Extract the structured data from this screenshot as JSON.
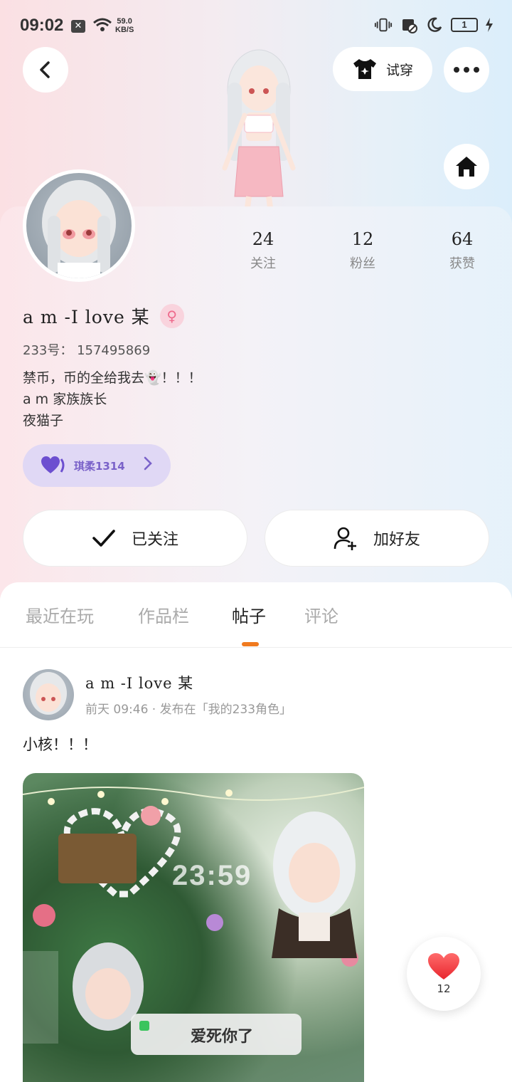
{
  "status_bar": {
    "time": "09:02",
    "net_speed_value": "59.0",
    "net_speed_unit": "KB/S",
    "battery": "1"
  },
  "header": {
    "try_on_label": "试穿"
  },
  "profile": {
    "stats": [
      {
        "value": "24",
        "label": "关注"
      },
      {
        "value": "12",
        "label": "粉丝"
      },
      {
        "value": "64",
        "label": "获赞"
      }
    ],
    "username": "a m -I love 某",
    "gender_symbol": "♀",
    "uid": "233号： 157495869",
    "bio_lines": [
      "禁币，币的全给我去👻！！！",
      "a m 家族族长",
      "夜猫子"
    ],
    "fan_badge": "琪柔1314",
    "followed_label": "已关注",
    "add_friend_label": "加好友"
  },
  "tabs": [
    {
      "label": "最近在玩",
      "active": false
    },
    {
      "label": "作品栏",
      "active": false
    },
    {
      "label": "帖子",
      "active": true
    },
    {
      "label": "评论",
      "active": false
    }
  ],
  "post": {
    "author": "a m -I love 某",
    "meta": "前天 09:46 · 发布在「我的233角色」",
    "text": "小核！！！",
    "image_clock": "23:59",
    "image_notice": "爱死你了"
  },
  "like": {
    "count": "12"
  },
  "colors": {
    "accent": "#f07a1f",
    "like_heart": "#f23b3b",
    "gender_pink": "#ee6a8c",
    "fan_badge_purple": "#7a62c9"
  }
}
